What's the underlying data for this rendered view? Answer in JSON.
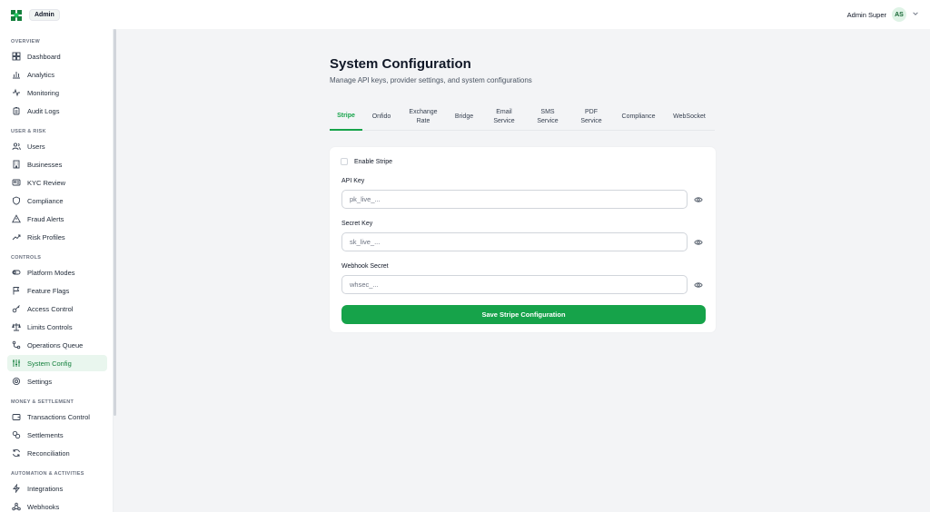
{
  "header": {
    "brand_tag": "Admin",
    "user_name": "Admin Super",
    "user_initials": "AS"
  },
  "sidebar": {
    "sections": [
      {
        "title": "OVERVIEW",
        "items": [
          {
            "label": "Dashboard",
            "icon": "dashboard-icon"
          },
          {
            "label": "Analytics",
            "icon": "bar-chart-icon"
          },
          {
            "label": "Monitoring",
            "icon": "activity-icon"
          },
          {
            "label": "Audit Logs",
            "icon": "clipboard-icon"
          }
        ]
      },
      {
        "title": "USER & RISK",
        "items": [
          {
            "label": "Users",
            "icon": "users-icon"
          },
          {
            "label": "Businesses",
            "icon": "building-icon"
          },
          {
            "label": "KYC Review",
            "icon": "id-card-icon"
          },
          {
            "label": "Compliance",
            "icon": "shield-icon"
          },
          {
            "label": "Fraud Alerts",
            "icon": "alert-triangle-icon"
          },
          {
            "label": "Risk Profiles",
            "icon": "trending-up-icon"
          }
        ]
      },
      {
        "title": "CONTROLS",
        "items": [
          {
            "label": "Platform Modes",
            "icon": "toggle-icon"
          },
          {
            "label": "Feature Flags",
            "icon": "flag-icon"
          },
          {
            "label": "Access Control",
            "icon": "key-icon"
          },
          {
            "label": "Limits Controls",
            "icon": "scale-icon"
          },
          {
            "label": "Operations Queue",
            "icon": "workflow-icon"
          },
          {
            "label": "System Config",
            "icon": "sliders-icon",
            "active": true
          },
          {
            "label": "Settings",
            "icon": "gear-icon"
          }
        ]
      },
      {
        "title": "MONEY & SETTLEMENT",
        "items": [
          {
            "label": "Transactions Control",
            "icon": "wallet-icon"
          },
          {
            "label": "Settlements",
            "icon": "coins-icon"
          },
          {
            "label": "Reconciliation",
            "icon": "refresh-icon"
          }
        ]
      },
      {
        "title": "AUTOMATION & ACTIVITIES",
        "items": [
          {
            "label": "Integrations",
            "icon": "zap-icon"
          },
          {
            "label": "Webhooks",
            "icon": "webhook-icon"
          }
        ]
      }
    ]
  },
  "main": {
    "title": "System Configuration",
    "subtitle": "Manage API keys, provider settings, and system configurations",
    "tabs": [
      {
        "label": "Stripe",
        "active": true
      },
      {
        "label": "Onfido"
      },
      {
        "label": "Exchange\nRate"
      },
      {
        "label": "Bridge"
      },
      {
        "label": "Email\nService"
      },
      {
        "label": "SMS\nService"
      },
      {
        "label": "PDF\nService"
      },
      {
        "label": "Compliance"
      },
      {
        "label": "WebSocket"
      }
    ],
    "form": {
      "enable_label": "Enable Stripe",
      "api_key_label": "API Key",
      "api_key_placeholder": "pk_live_...",
      "secret_key_label": "Secret Key",
      "secret_key_placeholder": "sk_live_...",
      "webhook_secret_label": "Webhook Secret",
      "webhook_secret_placeholder": "whsec_...",
      "save_label": "Save Stripe Configuration"
    }
  },
  "colors": {
    "accent": "#16a34a",
    "active_bg": "#e9f6ee",
    "brand": "#15803d"
  }
}
